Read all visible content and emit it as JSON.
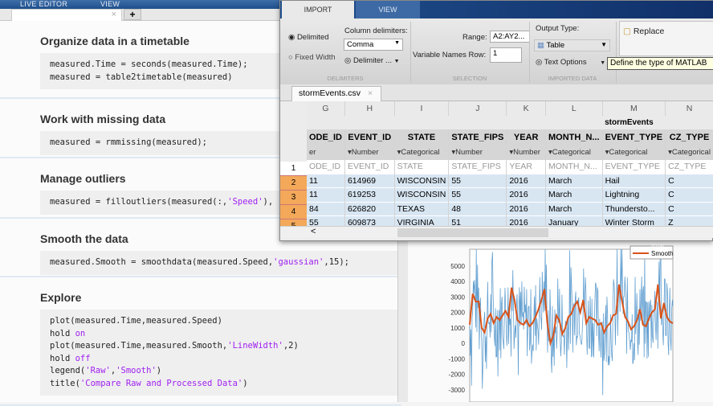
{
  "editor": {
    "tabs": [
      "LIVE EDITOR",
      "VIEW"
    ],
    "file_tab_close": "×",
    "add_tab": "+",
    "sections": [
      {
        "heading": "Organize data in a timetable",
        "code": [
          [
            [
              "measured.Time = seconds(measured.Time);",
              ""
            ]
          ],
          [
            [
              "measured = table2timetable(measured)",
              ""
            ]
          ]
        ]
      },
      {
        "heading": "Work with missing data",
        "code": [
          [
            [
              "measured = rmmissing(measured);",
              ""
            ]
          ]
        ]
      },
      {
        "heading": "Manage outliers",
        "code": [
          [
            [
              "measured = filloutliers(measured(:,",
              ""
            ],
            [
              "'Speed'",
              "s"
            ],
            [
              "),",
              ""
            ]
          ]
        ]
      },
      {
        "heading": "Smooth the data",
        "code": [
          [
            [
              "measured.Smooth = smoothdata(measured.Speed,",
              ""
            ],
            [
              "'gaussian'",
              "s"
            ],
            [
              ",15);",
              ""
            ]
          ]
        ]
      },
      {
        "heading": "Explore",
        "code": [
          [
            [
              "plot(measured.Time,measured.Speed)",
              ""
            ]
          ],
          [
            [
              "hold ",
              ""
            ],
            [
              "on",
              "s"
            ]
          ],
          [
            [
              "plot(measured.Time,measured.Smooth,",
              ""
            ],
            [
              "'LineWidth'",
              "s"
            ],
            [
              ",2)",
              ""
            ]
          ],
          [
            [
              "hold ",
              ""
            ],
            [
              "off",
              "s"
            ]
          ],
          [
            [
              "legend(",
              ""
            ],
            [
              "'Raw'",
              "s"
            ],
            [
              ",",
              ""
            ],
            [
              "'Smooth'",
              "s"
            ],
            [
              ")",
              ""
            ]
          ],
          [
            [
              "title(",
              ""
            ],
            [
              "'Compare Raw and Processed Data'",
              "s"
            ],
            [
              ")",
              ""
            ]
          ]
        ]
      }
    ]
  },
  "import": {
    "tabs": [
      "IMPORT",
      "VIEW"
    ],
    "delimited": "Delimited",
    "fixed_width": "Fixed Width",
    "column_delimiters_label": "Column delimiters:",
    "column_delimiter": "Comma",
    "delimiter_options": "Delimiter ...",
    "range_label": "Range:",
    "range": "A2:AY2...",
    "var_names_row_label": "Variable Names Row:",
    "var_names_row": "1",
    "output_type_label": "Output Type:",
    "output_type": "Table",
    "text_options": "Text Options",
    "replace": "Replace",
    "groups": [
      "DELIMITERS",
      "SELECTION",
      "IMPORTED DATA"
    ],
    "tooltip": "Define the type of MATLAB",
    "file_tab": "stormEvents.csv",
    "file_close": "×",
    "table_name": "stormEvents",
    "col_letters": [
      "G",
      "H",
      "I",
      "J",
      "K",
      "L",
      "M",
      "N"
    ],
    "var_names": [
      "ODE_ID",
      "EVENT_ID",
      "STATE",
      "STATE_FIPS",
      "YEAR",
      "MONTH_N...",
      "EVENT_TYPE",
      "CZ_TYPE"
    ],
    "var_types": [
      "er",
      "Number",
      "Categorical",
      "Number",
      "Number",
      "Categorical",
      "Categorical",
      "Categorical"
    ],
    "rows": [
      [
        "1",
        [
          "ODE_ID",
          "EVENT_ID",
          "STATE",
          "STATE_FIPS",
          "YEAR",
          "MONTH_N...",
          "EVENT_TYPE",
          "CZ_TYPE"
        ]
      ],
      [
        "2",
        [
          "11",
          "614969",
          "WISCONSIN",
          "55",
          "2016",
          "March",
          "Hail",
          "C"
        ]
      ],
      [
        "3",
        [
          "11",
          "619253",
          "WISCONSIN",
          "55",
          "2016",
          "March",
          "Lightning",
          "C"
        ]
      ],
      [
        "4",
        [
          "84",
          "626820",
          "TEXAS",
          "48",
          "2016",
          "March",
          "Thundersto...",
          "C"
        ]
      ],
      [
        "5",
        [
          "55",
          "609873",
          "VIRGINIA",
          "51",
          "2016",
          "January",
          "Winter Storm",
          "Z"
        ]
      ]
    ],
    "scroll_left": "<"
  },
  "chart_data": {
    "type": "line",
    "title": "Compare Raw and Processed Data",
    "ylim": [
      -3500,
      5700
    ],
    "yticks": [
      5000,
      4000,
      3000,
      2000,
      1000,
      0,
      -1000,
      -2000,
      -3000
    ],
    "legend": [
      "Raw",
      "Smooth"
    ],
    "legend_placement": "top-right",
    "series": [
      {
        "name": "Smooth",
        "color": "#d95319",
        "values": [
          1200,
          3200,
          2700,
          2700,
          1000,
          700,
          1600,
          1900,
          1300,
          1700,
          1500,
          1800,
          2100,
          1700,
          3600,
          2800,
          1500,
          1300,
          1200,
          1500,
          1100,
          1300,
          1700,
          2200,
          2800,
          3500,
          1300,
          0,
          500,
          1800,
          1500,
          600,
          1000,
          1700,
          1900,
          2400,
          2700,
          2000,
          2800,
          1300,
          1700,
          1600,
          1500,
          1200,
          1300,
          700,
          1100,
          1300,
          1800,
          1900,
          3800,
          2700,
          1700,
          1400,
          900,
          1100,
          1500,
          2200,
          1200,
          1100,
          1600,
          2000,
          2200,
          3800,
          1600,
          2600,
          1700,
          1400,
          1300
        ]
      },
      {
        "name": "Raw",
        "color": "#3b87c4",
        "values": []
      }
    ]
  }
}
